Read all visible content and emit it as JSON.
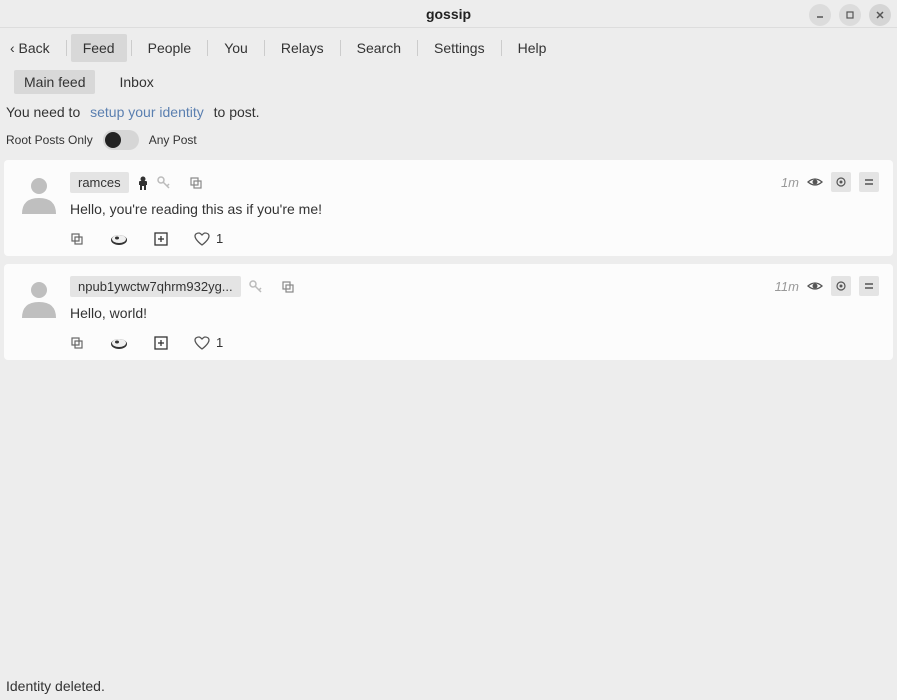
{
  "window": {
    "title": "gossip"
  },
  "nav": {
    "back": "‹ Back",
    "items": [
      "Feed",
      "People",
      "You",
      "Relays",
      "Search",
      "Settings",
      "Help"
    ],
    "active": "Feed"
  },
  "subnav": {
    "items": [
      "Main feed",
      "Inbox"
    ],
    "active": "Main feed"
  },
  "notice": {
    "prefix": "You need to",
    "link": "setup your identity",
    "suffix": "to post."
  },
  "toggle": {
    "left_label": "Root Posts Only",
    "right_label": "Any Post"
  },
  "posts": [
    {
      "username": "ramces",
      "show_person_icon": true,
      "timestamp": "1m",
      "content": "Hello, you're reading this as if you're me!",
      "likes": "1"
    },
    {
      "username": "npub1ywctw7qhrm932yg...",
      "show_person_icon": false,
      "timestamp": "11m",
      "content": "Hello, world!",
      "likes": "1"
    }
  ],
  "status": "Identity deleted."
}
